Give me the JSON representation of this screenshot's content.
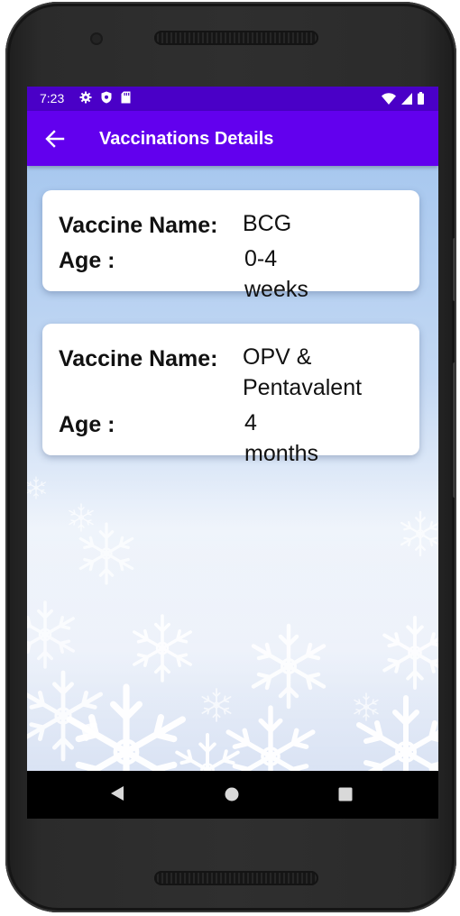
{
  "status_bar": {
    "time": "7:23",
    "left_icons": [
      "gear-icon",
      "shield-icon",
      "sd-card-icon"
    ],
    "right_icons": [
      "wifi-icon",
      "signal-icon",
      "battery-icon"
    ]
  },
  "app_bar": {
    "title": "Vaccinations Details",
    "back_icon": "arrow-left-icon"
  },
  "vaccines": [
    {
      "name_label": "Vaccine Name:",
      "name_value": "BCG",
      "age_label": "Age  :",
      "age_value": "0-4 weeks"
    },
    {
      "name_label": "Vaccine Name:",
      "name_value": "OPV &\nPentavalent",
      "age_label": "Age  :",
      "age_value": "4 months"
    }
  ],
  "nav_bar": {
    "buttons": [
      "back-triangle-icon",
      "home-circle-icon",
      "recents-square-icon"
    ]
  },
  "colors": {
    "status_bar": "#4a00c7",
    "app_bar": "#6200ee",
    "card_background": "#ffffff"
  }
}
